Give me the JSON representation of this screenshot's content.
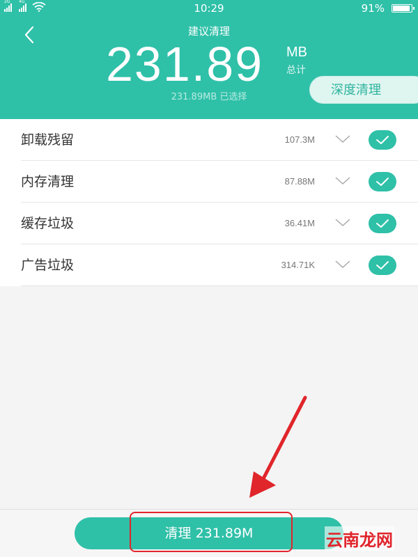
{
  "status_bar": {
    "sim1_tag": "2G",
    "sim2_tag": "4G",
    "time": "10:29",
    "battery_percent": "91%",
    "battery_level": 0.91
  },
  "header": {
    "title": "建议清理",
    "amount": "231.89",
    "amount_unit": "MB",
    "amount_caption": "总计",
    "selected_text": "231.89MB 已选择",
    "deep_clean_label": "深度清理",
    "back_icon": "chevron-left-icon"
  },
  "items": [
    {
      "label": "卸载残留",
      "size": "107.3M",
      "checked": true
    },
    {
      "label": "内存清理",
      "size": "87.88M",
      "checked": true
    },
    {
      "label": "缓存垃圾",
      "size": "36.41M",
      "checked": true
    },
    {
      "label": "广告垃圾",
      "size": "314.71K",
      "checked": true
    }
  ],
  "footer": {
    "clean_button_label": "清理 231.89M"
  },
  "watermark": "云南龙网",
  "colors": {
    "accent": "#2fc0a8",
    "annotation": "#e0252b",
    "list_text": "#333333",
    "size_text": "#777777",
    "background": "#f4f4f4"
  }
}
